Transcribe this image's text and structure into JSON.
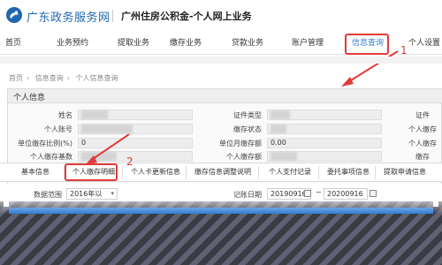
{
  "header": {
    "site_name": "广东政务服务网",
    "business_title": "广州住房公积金-个人网上业务"
  },
  "nav": {
    "items": [
      "首页",
      "业务预约",
      "提取业务",
      "信息查询"
    ]
  },
  "nav_partial": {
    "i1": "缴存业务",
    "i2": "贷款业务",
    "i3": "账户管理",
    "i4": "个人设置"
  },
  "annotations": {
    "one": "1",
    "two": "2",
    "color": "#e23b3b"
  },
  "breadcrumb": [
    "首页",
    "信息查询",
    "个人信息查询"
  ],
  "panel": {
    "title": "个人信息"
  },
  "fields": {
    "name_label": "姓名",
    "account_label": "个人账号",
    "ratio_label": "单位缴存比例(%)",
    "deposit_base_label": "个人缴存基数",
    "id_type_label": "证件类型",
    "status_label": "缴存状态",
    "unit_amount_label": "单位月缴存额",
    "personal_amount_label": "个人缴存额",
    "ratio_value": "0",
    "amount_value": "0.00",
    "right_cut_1": "证件",
    "right_cut_2": "个人缴存",
    "right_cut_3": "个人缴存",
    "right_cut_4": "缴存"
  },
  "tabs": [
    "基本信息",
    "个人缴存明细",
    "个人卡更新信息",
    "缴存信息调整说明",
    "个人支付记录",
    "委托事项信息",
    "提取申请信息"
  ],
  "query": {
    "year_label": "数据范围",
    "year_value": "2016年以",
    "date_label": "记账日期",
    "date_from": "20190916",
    "date_to": "20200916",
    "dash": "~"
  },
  "colors": {
    "accent": "#2f7fd6",
    "brand": "#1f66b3"
  }
}
